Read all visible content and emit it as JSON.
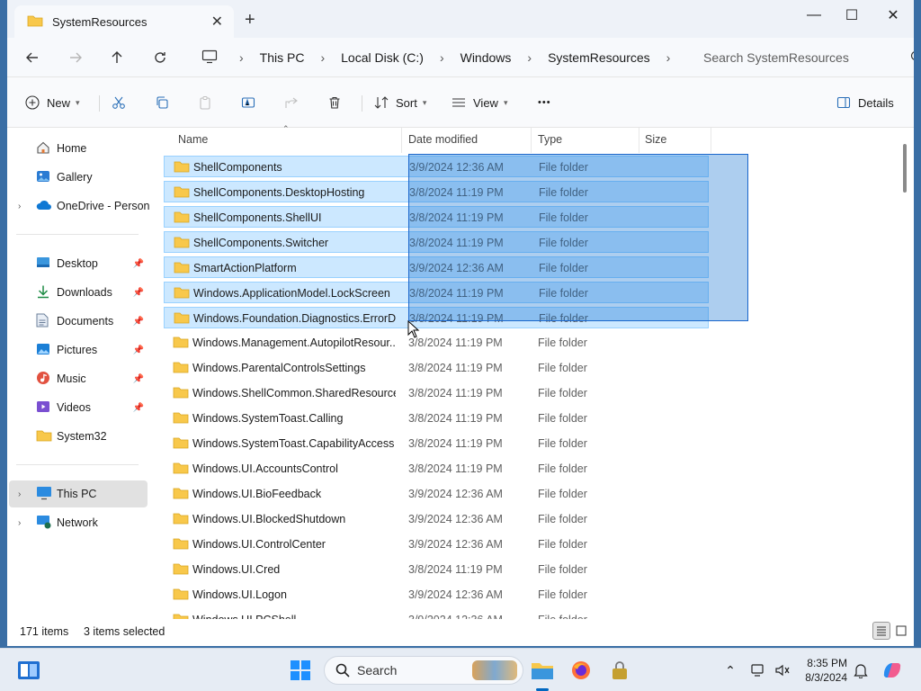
{
  "window": {
    "tab_title": "SystemResources",
    "new_tab": "+",
    "controls": {
      "minimize": "—",
      "maximize": "☐",
      "close": "✕"
    }
  },
  "address": {
    "crumbs": [
      "This PC",
      "Local Disk (C:)",
      "Windows",
      "SystemResources"
    ],
    "separator": "›",
    "search_placeholder": "Search SystemResources"
  },
  "commands": {
    "new": "New",
    "sort": "Sort",
    "view": "View",
    "more": "•••",
    "details": "Details"
  },
  "nav": {
    "items": [
      {
        "label": "Home",
        "icon": "home-icon"
      },
      {
        "label": "Gallery",
        "icon": "gallery-icon"
      },
      {
        "label": "OneDrive - Persona",
        "icon": "cloud-icon"
      },
      {
        "label": "Desktop",
        "icon": "desktop-icon"
      },
      {
        "label": "Downloads",
        "icon": "download-icon"
      },
      {
        "label": "Documents",
        "icon": "documents-icon"
      },
      {
        "label": "Pictures",
        "icon": "pictures-icon"
      },
      {
        "label": "Music",
        "icon": "music-icon"
      },
      {
        "label": "Videos",
        "icon": "videos-icon"
      },
      {
        "label": "System32",
        "icon": "folder-icon"
      },
      {
        "label": "This PC",
        "icon": "computer-icon"
      },
      {
        "label": "Network",
        "icon": "network-icon"
      }
    ]
  },
  "columns": {
    "name": "Name",
    "date": "Date modified",
    "type": "Type",
    "size": "Size"
  },
  "files": [
    {
      "name": "ShellComponents",
      "date": "3/9/2024 12:36 AM",
      "type": "File folder",
      "selected": true
    },
    {
      "name": "ShellComponents.DesktopHosting",
      "date": "3/8/2024 11:19 PM",
      "type": "File folder",
      "selected": true
    },
    {
      "name": "ShellComponents.ShellUI",
      "date": "3/8/2024 11:19 PM",
      "type": "File folder",
      "selected": true
    },
    {
      "name": "ShellComponents.Switcher",
      "date": "3/8/2024 11:19 PM",
      "type": "File folder",
      "selected": true
    },
    {
      "name": "SmartActionPlatform",
      "date": "3/9/2024 12:36 AM",
      "type": "File folder",
      "selected": true
    },
    {
      "name": "Windows.ApplicationModel.LockScreen",
      "date": "3/8/2024 11:19 PM",
      "type": "File folder",
      "selected": true
    },
    {
      "name": "Windows.Foundation.Diagnostics.ErrorD...",
      "date": "3/8/2024 11:19 PM",
      "type": "File folder",
      "selected": true
    },
    {
      "name": "Windows.Management.AutopilotResour...",
      "date": "3/8/2024 11:19 PM",
      "type": "File folder",
      "selected": false
    },
    {
      "name": "Windows.ParentalControlsSettings",
      "date": "3/8/2024 11:19 PM",
      "type": "File folder",
      "selected": false
    },
    {
      "name": "Windows.ShellCommon.SharedResources",
      "date": "3/8/2024 11:19 PM",
      "type": "File folder",
      "selected": false
    },
    {
      "name": "Windows.SystemToast.Calling",
      "date": "3/8/2024 11:19 PM",
      "type": "File folder",
      "selected": false
    },
    {
      "name": "Windows.SystemToast.CapabilityAccess",
      "date": "3/8/2024 11:19 PM",
      "type": "File folder",
      "selected": false
    },
    {
      "name": "Windows.UI.AccountsControl",
      "date": "3/8/2024 11:19 PM",
      "type": "File folder",
      "selected": false
    },
    {
      "name": "Windows.UI.BioFeedback",
      "date": "3/9/2024 12:36 AM",
      "type": "File folder",
      "selected": false
    },
    {
      "name": "Windows.UI.BlockedShutdown",
      "date": "3/9/2024 12:36 AM",
      "type": "File folder",
      "selected": false
    },
    {
      "name": "Windows.UI.ControlCenter",
      "date": "3/9/2024 12:36 AM",
      "type": "File folder",
      "selected": false
    },
    {
      "name": "Windows.UI.Cred",
      "date": "3/8/2024 11:19 PM",
      "type": "File folder",
      "selected": false
    },
    {
      "name": "Windows.UI.Logon",
      "date": "3/9/2024 12:36 AM",
      "type": "File folder",
      "selected": false
    },
    {
      "name": "Windows.UI.PCShell",
      "date": "3/9/2024 12:36 AM",
      "type": "File folder",
      "selected": false
    }
  ],
  "status": {
    "item_count": "171 items",
    "selected_count": "3 items selected"
  },
  "taskbar": {
    "search_placeholder": "Search",
    "time": "8:35 PM",
    "date": "8/3/2024"
  },
  "colors": {
    "accent": "#0067c0",
    "selection": "#cce8ff",
    "folder": "#f8c84b",
    "marquee": "#1a66cc"
  }
}
